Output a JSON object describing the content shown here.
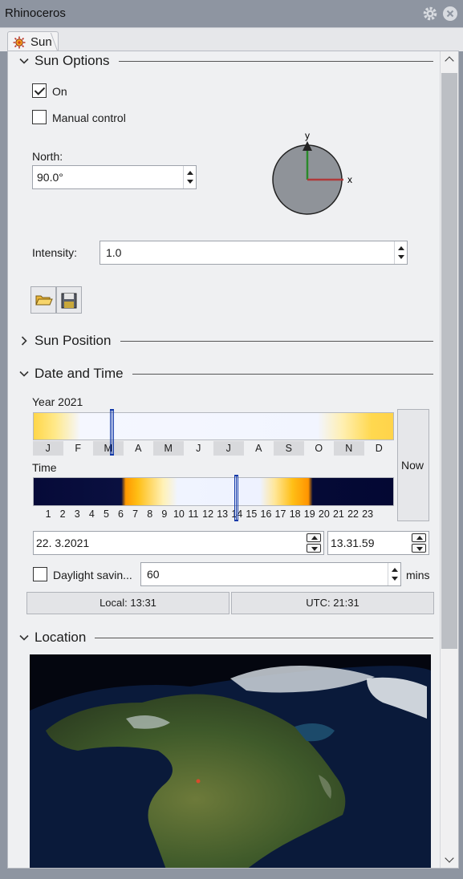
{
  "window": {
    "title": "Rhinoceros"
  },
  "tab": {
    "label": "Sun"
  },
  "sections": {
    "sun_options": "Sun Options",
    "sun_position": "Sun Position",
    "date_time": "Date and Time",
    "location": "Location"
  },
  "sun_options": {
    "on_label": "On",
    "on_checked": true,
    "manual_label": "Manual control",
    "manual_checked": false,
    "north_label": "North:",
    "north_value": "90.0°",
    "compass_y": "y",
    "compass_x": "x",
    "intensity_label": "Intensity:",
    "intensity_value": "1.0"
  },
  "date_time": {
    "year_label": "Year 2021",
    "months": [
      "J",
      "F",
      "M",
      "A",
      "M",
      "J",
      "J",
      "A",
      "S",
      "O",
      "N",
      "D"
    ],
    "time_label": "Time",
    "hours": [
      "1",
      "2",
      "3",
      "4",
      "5",
      "6",
      "7",
      "8",
      "9",
      "10",
      "11",
      "12",
      "13",
      "14",
      "15",
      "16",
      "17",
      "18",
      "19",
      "20",
      "21",
      "22",
      "23"
    ],
    "year_marker_fraction": 0.22,
    "time_marker_fraction": 0.564,
    "now_label": "Now",
    "date_value": "22.  3.2021",
    "time_value": "13.31.59",
    "daylight_label": "Daylight savin...",
    "daylight_checked": false,
    "daylight_value": "60",
    "mins_label": "mins",
    "local_readout": "Local: 13:31",
    "utc_readout": "UTC: 21:31"
  },
  "colors": {
    "marker": "#1239a8",
    "compass_y_axis": "#2a8a2a",
    "compass_x_axis": "#b03a3a"
  }
}
